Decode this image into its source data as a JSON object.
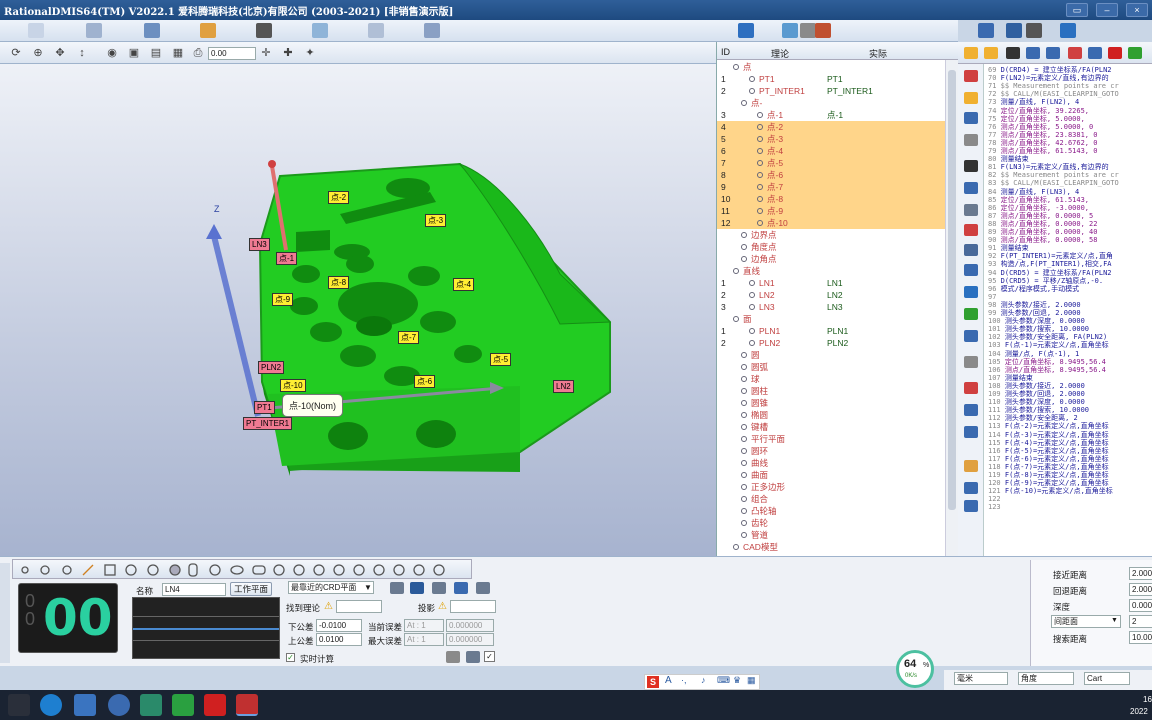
{
  "app": {
    "title": "RationalDMIS64(TM) V2022.1   爱科腾瑞科技(北京)有限公司 (2003-2021) [非销售演示版]"
  },
  "toolbar": {
    "scale_value": "0.00"
  },
  "viewport": {
    "axis_label": "Z",
    "tooltip": "点-10(Nom)",
    "labels": [
      {
        "text": "点-2",
        "kind": "yellow"
      },
      {
        "text": "点-3",
        "kind": "yellow"
      },
      {
        "text": "LN3",
        "kind": "pink"
      },
      {
        "text": "点-1",
        "kind": "pink"
      },
      {
        "text": "点-8",
        "kind": "yellow"
      },
      {
        "text": "点-4",
        "kind": "yellow"
      },
      {
        "text": "点-9",
        "kind": "yellow"
      },
      {
        "text": "点-7",
        "kind": "yellow"
      },
      {
        "text": "点-5",
        "kind": "yellow"
      },
      {
        "text": "PLN2",
        "kind": "pink"
      },
      {
        "text": "点-10",
        "kind": "yellow"
      },
      {
        "text": "点-6",
        "kind": "yellow"
      },
      {
        "text": "LN2",
        "kind": "pink"
      },
      {
        "text": "PT1",
        "kind": "pink"
      },
      {
        "text": "PT_INTER1",
        "kind": "pink"
      }
    ]
  },
  "tree": {
    "headers": {
      "id": "ID",
      "theory": "理论",
      "actual": "实际"
    },
    "rows": [
      {
        "id": "",
        "theory": "点",
        "actual": "",
        "indent": 0,
        "group": true
      },
      {
        "id": "1",
        "theory": "PT1",
        "actual": "PT1",
        "indent": 2
      },
      {
        "id": "2",
        "theory": "PT_INTER1",
        "actual": "PT_INTER1",
        "indent": 2
      },
      {
        "id": "",
        "theory": "点-",
        "actual": "",
        "indent": 1,
        "group": true
      },
      {
        "id": "3",
        "theory": "点-1",
        "actual": "点-1",
        "indent": 3
      },
      {
        "id": "4",
        "theory": "点-2",
        "actual": "",
        "indent": 3,
        "hl": true
      },
      {
        "id": "5",
        "theory": "点-3",
        "actual": "",
        "indent": 3,
        "hl": true
      },
      {
        "id": "6",
        "theory": "点-4",
        "actual": "",
        "indent": 3,
        "hl": true
      },
      {
        "id": "7",
        "theory": "点-5",
        "actual": "",
        "indent": 3,
        "hl": true
      },
      {
        "id": "8",
        "theory": "点-6",
        "actual": "",
        "indent": 3,
        "hl": true
      },
      {
        "id": "9",
        "theory": "点-7",
        "actual": "",
        "indent": 3,
        "hl": true
      },
      {
        "id": "10",
        "theory": "点-8",
        "actual": "",
        "indent": 3,
        "hl": true
      },
      {
        "id": "11",
        "theory": "点-9",
        "actual": "",
        "indent": 3,
        "hl": true
      },
      {
        "id": "12",
        "theory": "点-10",
        "actual": "",
        "indent": 3,
        "hl": true
      },
      {
        "id": "",
        "theory": "边界点",
        "actual": "",
        "indent": 1,
        "group": true
      },
      {
        "id": "",
        "theory": "角度点",
        "actual": "",
        "indent": 1,
        "group": true
      },
      {
        "id": "",
        "theory": "边角点",
        "actual": "",
        "indent": 1,
        "group": true
      },
      {
        "id": "",
        "theory": "直线",
        "actual": "",
        "indent": 0,
        "group": true
      },
      {
        "id": "1",
        "theory": "LN1",
        "actual": "LN1",
        "indent": 2
      },
      {
        "id": "2",
        "theory": "LN2",
        "actual": "LN2",
        "indent": 2
      },
      {
        "id": "3",
        "theory": "LN3",
        "actual": "LN3",
        "indent": 2
      },
      {
        "id": "",
        "theory": "面",
        "actual": "",
        "indent": 0,
        "group": true
      },
      {
        "id": "1",
        "theory": "PLN1",
        "actual": "PLN1",
        "indent": 2
      },
      {
        "id": "2",
        "theory": "PLN2",
        "actual": "PLN2",
        "indent": 2
      },
      {
        "id": "",
        "theory": "圆",
        "actual": "",
        "indent": 1,
        "group": true
      },
      {
        "id": "",
        "theory": "圆弧",
        "actual": "",
        "indent": 1,
        "group": true
      },
      {
        "id": "",
        "theory": "球",
        "actual": "",
        "indent": 1,
        "group": true
      },
      {
        "id": "",
        "theory": "圆柱",
        "actual": "",
        "indent": 1,
        "group": true
      },
      {
        "id": "",
        "theory": "圆锥",
        "actual": "",
        "indent": 1,
        "group": true
      },
      {
        "id": "",
        "theory": "椭圆",
        "actual": "",
        "indent": 1,
        "group": true
      },
      {
        "id": "",
        "theory": "键槽",
        "actual": "",
        "indent": 1,
        "group": true
      },
      {
        "id": "",
        "theory": "平行平面",
        "actual": "",
        "indent": 1,
        "group": true
      },
      {
        "id": "",
        "theory": "圆环",
        "actual": "",
        "indent": 1,
        "group": true
      },
      {
        "id": "",
        "theory": "曲线",
        "actual": "",
        "indent": 1,
        "group": true
      },
      {
        "id": "",
        "theory": "曲面",
        "actual": "",
        "indent": 1,
        "group": true
      },
      {
        "id": "",
        "theory": "正多边形",
        "actual": "",
        "indent": 1,
        "group": true
      },
      {
        "id": "",
        "theory": "组合",
        "actual": "",
        "indent": 1,
        "group": true
      },
      {
        "id": "",
        "theory": "凸轮轴",
        "actual": "",
        "indent": 1,
        "group": true
      },
      {
        "id": "",
        "theory": "齿轮",
        "actual": "",
        "indent": 1,
        "group": true
      },
      {
        "id": "",
        "theory": "管道",
        "actual": "",
        "indent": 1,
        "group": true
      },
      {
        "id": "",
        "theory": "CAD模型",
        "actual": "",
        "indent": 0,
        "group": true
      }
    ]
  },
  "code": {
    "lines": [
      {
        "n": "69",
        "t": "D(CRD4) = 建立坐标系/FA(PLN2",
        "c": "#1a1a9a"
      },
      {
        "n": "70",
        "t": "F(LN2)=元素定义/直线,有边界的",
        "c": "#1a1a9a"
      },
      {
        "n": "71",
        "t": "$$ Measurement points are cr",
        "c": "#888"
      },
      {
        "n": "72",
        "t": "$$ CALL/M(EASI_CLEARPIN_GOTO",
        "c": "#888"
      },
      {
        "n": "73",
        "t": "测量/直线, F(LN2), 4",
        "c": "#1a1a9a"
      },
      {
        "n": "74",
        "t": "  定位/直角坐标,   39.2265,",
        "c": "#8a1a8a"
      },
      {
        "n": "75",
        "t": "  定位/直角坐标,    5.0000,",
        "c": "#8a1a8a"
      },
      {
        "n": "76",
        "t": "  测点/直角坐标,  5.0000,  0",
        "c": "#8a1a8a"
      },
      {
        "n": "77",
        "t": "  测点/直角坐标, 23.8381,  0",
        "c": "#8a1a8a"
      },
      {
        "n": "78",
        "t": "  测点/直角坐标, 42.6762,  0",
        "c": "#8a1a8a"
      },
      {
        "n": "79",
        "t": "  测点/直角坐标, 61.5143,  0",
        "c": "#8a1a8a"
      },
      {
        "n": "80",
        "t": "测量结束",
        "c": "#1a1a9a"
      },
      {
        "n": "81",
        "t": "F(LN3)=元素定义/直线,有边界的",
        "c": "#1a1a9a"
      },
      {
        "n": "82",
        "t": "$$ Measurement points are cr",
        "c": "#888"
      },
      {
        "n": "83",
        "t": "$$ CALL/M(EASI_CLEARPIN_GOTO",
        "c": "#888"
      },
      {
        "n": "84",
        "t": "测量/直线, F(LN3), 4",
        "c": "#1a1a9a"
      },
      {
        "n": "85",
        "t": "  定位/直角坐标,   61.5143,",
        "c": "#8a1a8a"
      },
      {
        "n": "86",
        "t": "  定位/直角坐标,   -3.0000,",
        "c": "#8a1a8a"
      },
      {
        "n": "87",
        "t": "  测点/直角坐标,  0.0000,  5",
        "c": "#8a1a8a"
      },
      {
        "n": "88",
        "t": "  测点/直角坐标,  0.0000, 22",
        "c": "#8a1a8a"
      },
      {
        "n": "89",
        "t": "  测点/直角坐标,  0.0000, 40",
        "c": "#8a1a8a"
      },
      {
        "n": "90",
        "t": "  测点/直角坐标,  0.0000, 58",
        "c": "#8a1a8a"
      },
      {
        "n": "91",
        "t": "测量结束",
        "c": "#1a1a9a"
      },
      {
        "n": "92",
        "t": "F(PT_INTER1)=元素定义/点,直角",
        "c": "#1a1a9a"
      },
      {
        "n": "93",
        "t": "构造/点,F(PT_INTER1),相交,FA",
        "c": "#1a1a9a"
      },
      {
        "n": "94",
        "t": "D(CRD5) = 建立坐标系/FA(PLN2",
        "c": "#1a1a9a"
      },
      {
        "n": "95",
        "t": "D(CRD5) = 平移/Z轴原点,-0.",
        "c": "#1a1a9a"
      },
      {
        "n": "96",
        "t": "模式/程序模式,手动模式",
        "c": "#1a1a9a"
      },
      {
        "n": "97",
        "t": "",
        "c": "#1a1a9a"
      },
      {
        "n": "98",
        "t": "测头参数/接近, 2.0000",
        "c": "#1a1a9a"
      },
      {
        "n": "99",
        "t": "测头参数/回退, 2.0000",
        "c": "#1a1a9a"
      },
      {
        "n": "100",
        "t": "测头参数/深度, 0.0000",
        "c": "#1a1a9a"
      },
      {
        "n": "101",
        "t": "测头参数/搜索, 10.0000",
        "c": "#1a1a9a"
      },
      {
        "n": "102",
        "t": "测头参数/安全距离, FA(PLN2)",
        "c": "#1a1a9a"
      },
      {
        "n": "103",
        "t": "F(点-1)=元素定义/点,直角坐标",
        "c": "#1a1a9a"
      },
      {
        "n": "104",
        "t": "测量/点, F(点-1), 1",
        "c": "#1a1a9a"
      },
      {
        "n": "105",
        "t": "  定位/直角坐标, 8.9495,56.4",
        "c": "#8a1a8a"
      },
      {
        "n": "106",
        "t": "  测点/直角坐标, 8.9495,56.4",
        "c": "#8a1a8a"
      },
      {
        "n": "107",
        "t": "测量结束",
        "c": "#1a1a9a"
      },
      {
        "n": "108",
        "t": "测头参数/接近, 2.0000",
        "c": "#1a1a9a"
      },
      {
        "n": "109",
        "t": "测头参数/回退, 2.0000",
        "c": "#1a1a9a"
      },
      {
        "n": "110",
        "t": "测头参数/深度, 0.0000",
        "c": "#1a1a9a"
      },
      {
        "n": "111",
        "t": "测头参数/搜索, 10.0000",
        "c": "#1a1a9a"
      },
      {
        "n": "112",
        "t": "测头参数/安全距离, 2",
        "c": "#1a1a9a"
      },
      {
        "n": "113",
        "t": "F(点-2)=元素定义/点,直角坐标",
        "c": "#1a1a9a"
      },
      {
        "n": "114",
        "t": "F(点-3)=元素定义/点,直角坐标",
        "c": "#1a1a9a"
      },
      {
        "n": "115",
        "t": "F(点-4)=元素定义/点,直角坐标",
        "c": "#1a1a9a"
      },
      {
        "n": "116",
        "t": "F(点-5)=元素定义/点,直角坐标",
        "c": "#1a1a9a"
      },
      {
        "n": "117",
        "t": "F(点-6)=元素定义/点,直角坐标",
        "c": "#1a1a9a"
      },
      {
        "n": "118",
        "t": "F(点-7)=元素定义/点,直角坐标",
        "c": "#1a1a9a"
      },
      {
        "n": "119",
        "t": "F(点-8)=元素定义/点,直角坐标",
        "c": "#1a1a9a"
      },
      {
        "n": "120",
        "t": "F(点-9)=元素定义/点,直角坐标",
        "c": "#1a1a9a"
      },
      {
        "n": "121",
        "t": "F(点-10)=元素定义/点,直角坐标",
        "c": "#1a1a9a"
      },
      {
        "n": "122",
        "t": "",
        "c": "#1a1a9a"
      },
      {
        "n": "123",
        "t": "",
        "c": "#1a1a9a"
      }
    ]
  },
  "bottom": {
    "digital": "00",
    "name_label": "名称",
    "name_value": "LN4",
    "workplane_btn": "工作平面",
    "crd_select": "最靠近的CRD平面",
    "find_theory": "找到理论",
    "projection": "投影",
    "lower_tol_label": "下公差",
    "lower_tol": "-0.0100",
    "upper_tol_label": "上公差",
    "upper_tol": "0.0100",
    "cur_err_label": "当前误差",
    "max_err_label": "最大误差",
    "at1": "At : 1",
    "at2": "At : 1",
    "zero1": "0.000000",
    "zero2": "0.000000",
    "realtime": "实时计算"
  },
  "right_panel": {
    "items": [
      {
        "label": "接近距离",
        "value": "2.000"
      },
      {
        "label": "回退距离",
        "value": "2.000"
      },
      {
        "label": "深度",
        "value": "0.000"
      },
      {
        "label": "间距面",
        "value": "2"
      },
      {
        "label": "搜索距离",
        "value": "10.00"
      }
    ]
  },
  "status": {
    "unit": "毫米",
    "angle": "角度",
    "coord": "Cart",
    "perf_pct": "64",
    "perf_unit": "%",
    "net_speed": "0K/s",
    "clock_top": "16",
    "clock_bottom": "2022"
  },
  "colors": {
    "part": "#22cc22",
    "highlight": "#ffd58a",
    "title": "#1e4a80"
  }
}
